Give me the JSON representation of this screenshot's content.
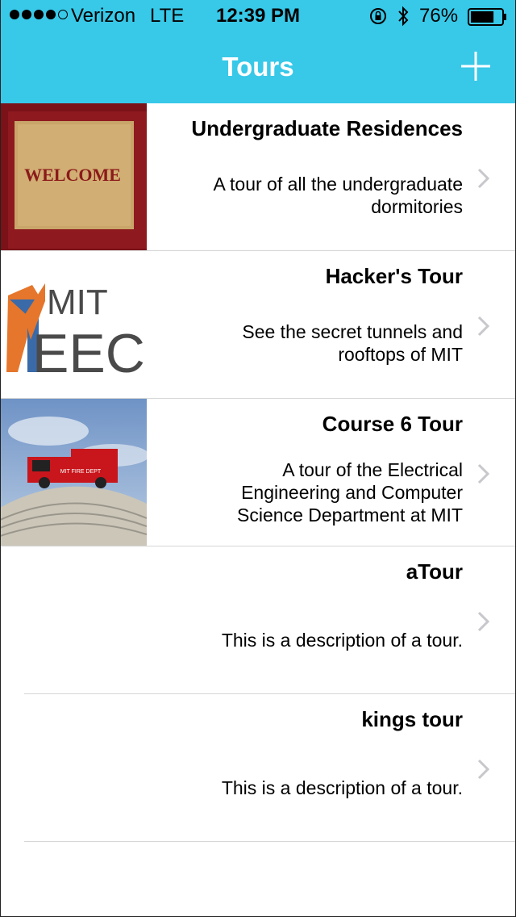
{
  "status_bar": {
    "carrier": "Verizon",
    "network": "LTE",
    "time": "12:39 PM",
    "battery": "76%",
    "battery_level": 0.76,
    "signal_bars": 4,
    "icons": [
      "rotation-lock-icon",
      "bluetooth-icon",
      "battery-icon"
    ]
  },
  "nav": {
    "title": "Tours",
    "add_icon": "plus-icon"
  },
  "colors": {
    "nav_background": "#38c8e8",
    "nav_text": "#ffffff",
    "chevron": "#c7c7cc"
  },
  "tours": [
    {
      "title": "Undergraduate Residences",
      "description": "A tour of all the undergraduate dormitories",
      "thumbnail": "welcome-mat-image",
      "mat_text": "WELCOME"
    },
    {
      "title": "Hacker's Tour",
      "description": "See the secret tunnels and rooftops of MIT",
      "thumbnail": "mit-eecs-logo",
      "logo_top": "MIT",
      "logo_bottom": "EECS"
    },
    {
      "title": "Course 6 Tour",
      "description": "A tour of the Electrical Engineering and Computer Science Department at MIT",
      "thumbnail": "firetruck-on-dome-image",
      "truck_text": "MIT FIRE DEPT"
    },
    {
      "title": "aTour",
      "description": "This is a description of a tour.",
      "thumbnail": null
    },
    {
      "title": "kings tour",
      "description": "This is a description of a tour.",
      "thumbnail": null
    }
  ]
}
